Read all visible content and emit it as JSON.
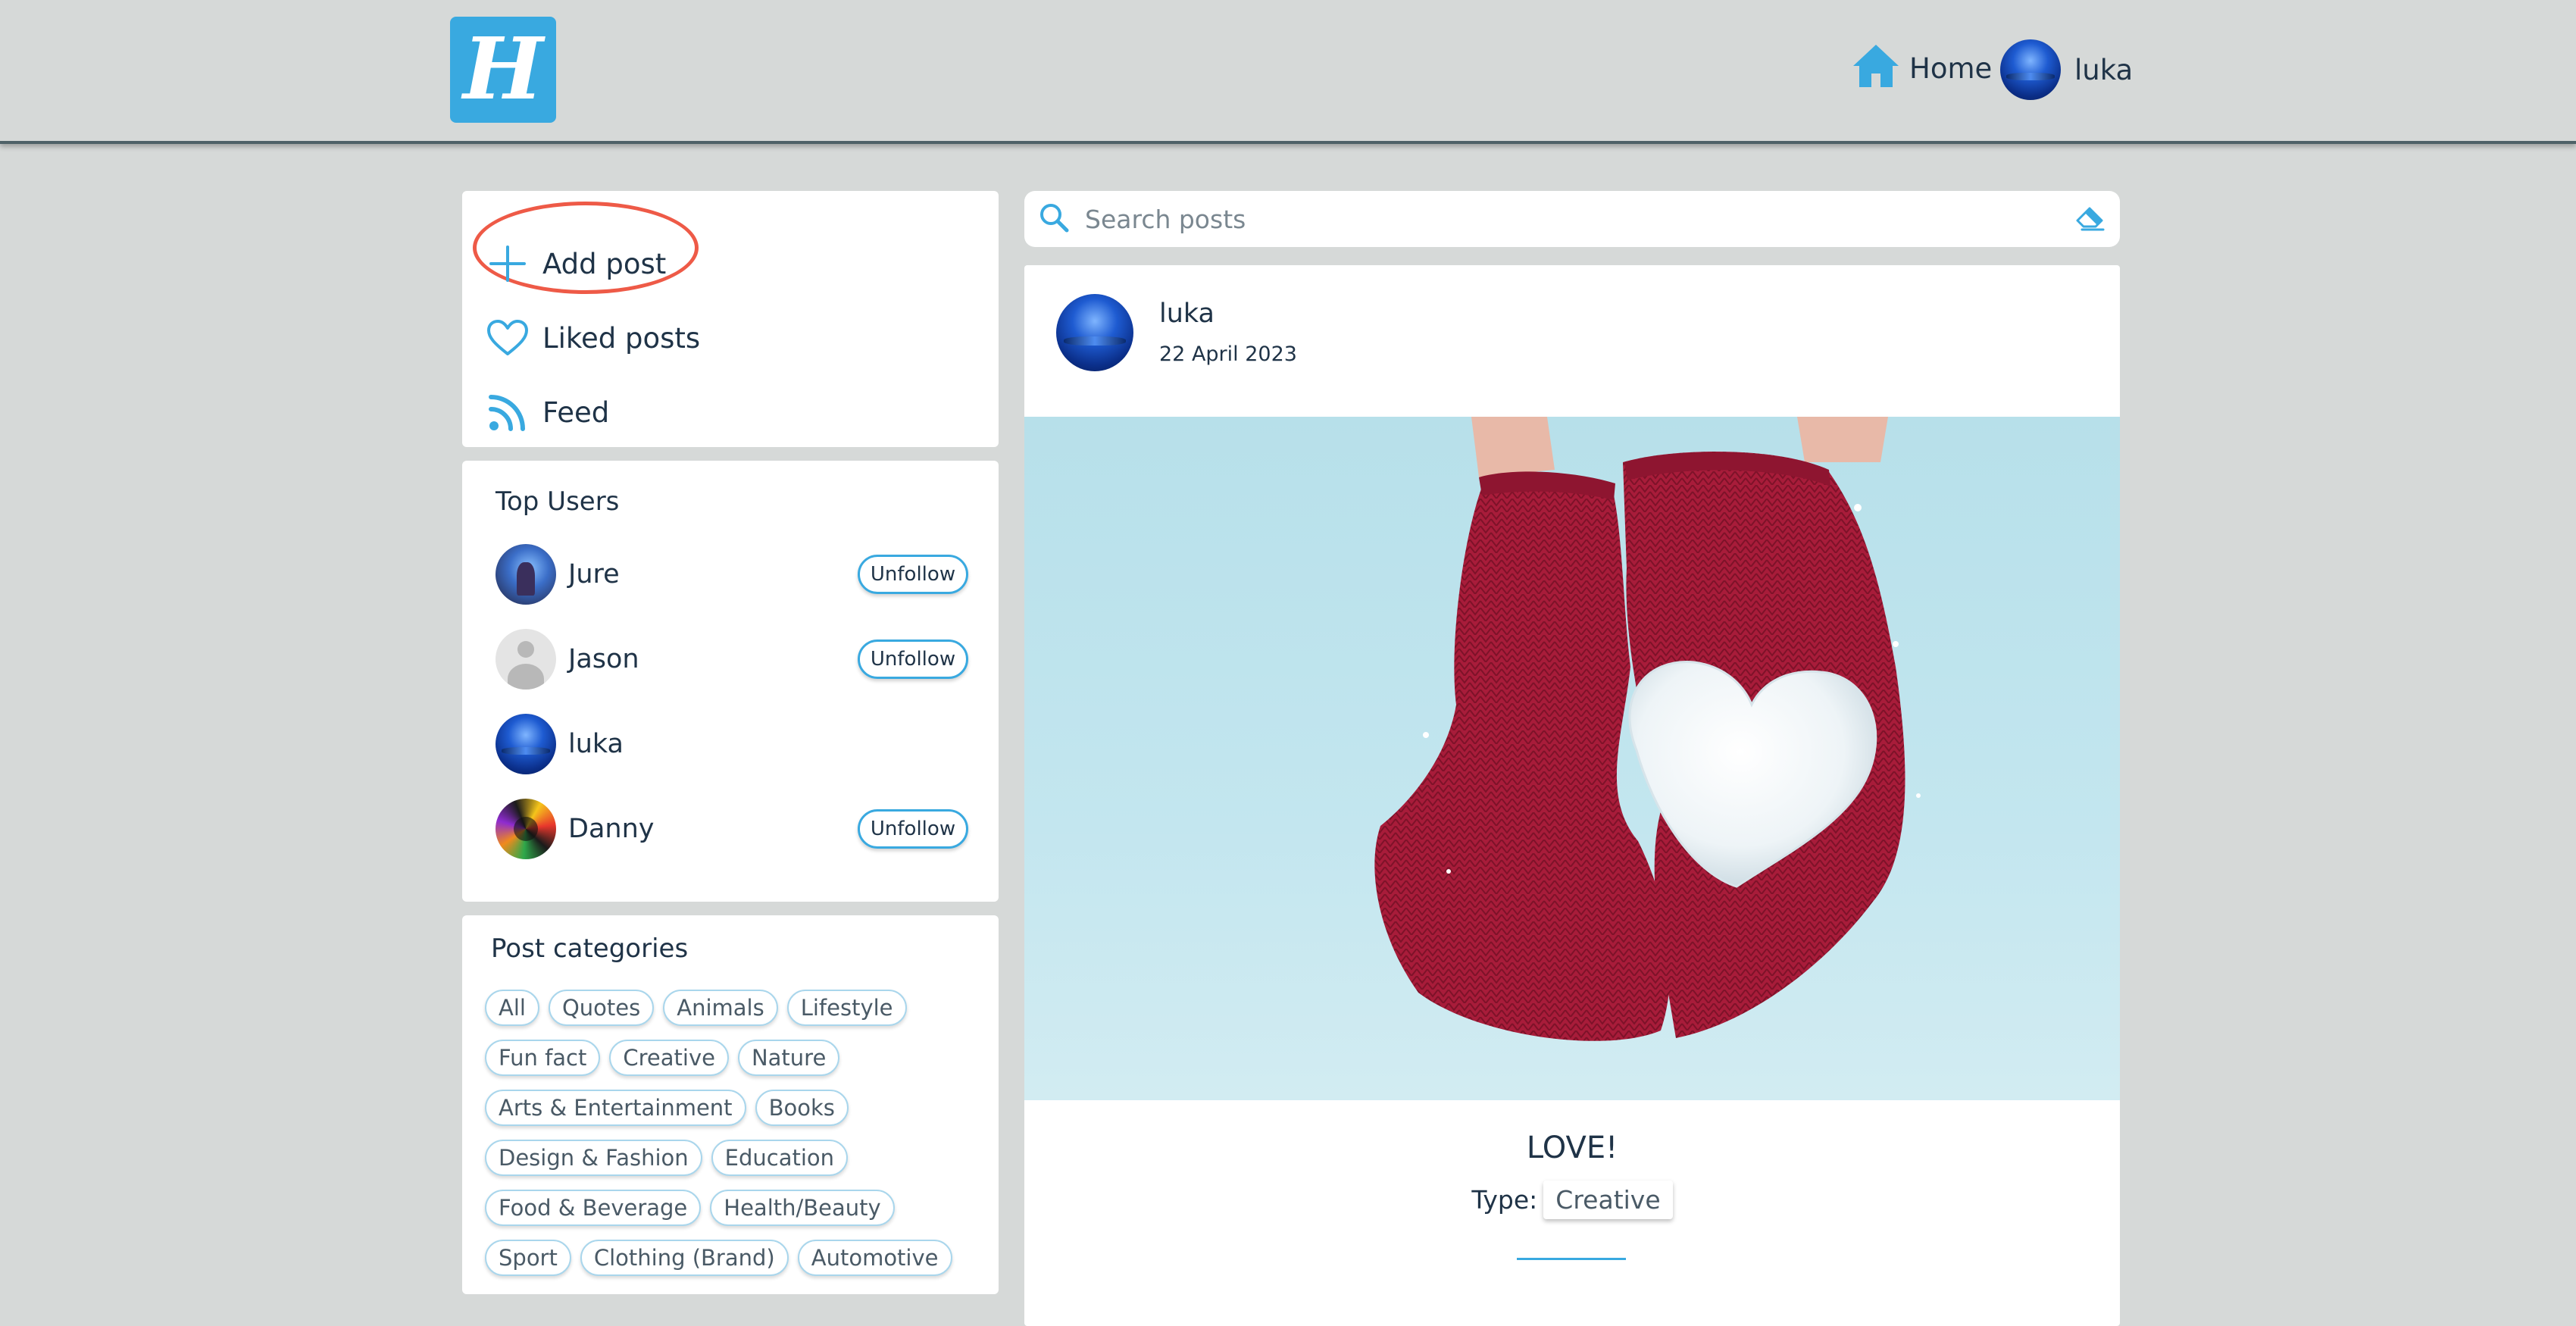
{
  "header": {
    "logo_letter": "H",
    "home_label": "Home",
    "user_name": "luka"
  },
  "menu": {
    "items": [
      {
        "label": "Add post",
        "icon": "plus-icon"
      },
      {
        "label": "Liked posts",
        "icon": "heart-icon"
      },
      {
        "label": "Feed",
        "icon": "rss-icon"
      }
    ]
  },
  "top_users": {
    "title": "Top Users",
    "users": [
      {
        "name": "Jure",
        "action": "Unfollow"
      },
      {
        "name": "Jason",
        "action": "Unfollow"
      },
      {
        "name": "luka",
        "action": ""
      },
      {
        "name": "Danny",
        "action": "Unfollow"
      }
    ]
  },
  "categories": {
    "title": "Post categories",
    "items": [
      "All",
      "Quotes",
      "Animals",
      "Lifestyle",
      "Fun fact",
      "Creative",
      "Nature",
      "Arts & Entertainment",
      "Books",
      "Design & Fashion",
      "Education",
      "Food & Beverage",
      "Health/Beauty",
      "Sport",
      "Clothing (Brand)",
      "Automotive"
    ]
  },
  "search": {
    "placeholder": "Search posts"
  },
  "post": {
    "author": "luka",
    "date": "22 April 2023",
    "title": "LOVE!",
    "type_label": "Type:",
    "type_value": "Creative"
  },
  "colors": {
    "accent": "#39a9e0",
    "highlight": "#ee5a47",
    "background": "#d6d9d8",
    "text": "#1f3347"
  }
}
